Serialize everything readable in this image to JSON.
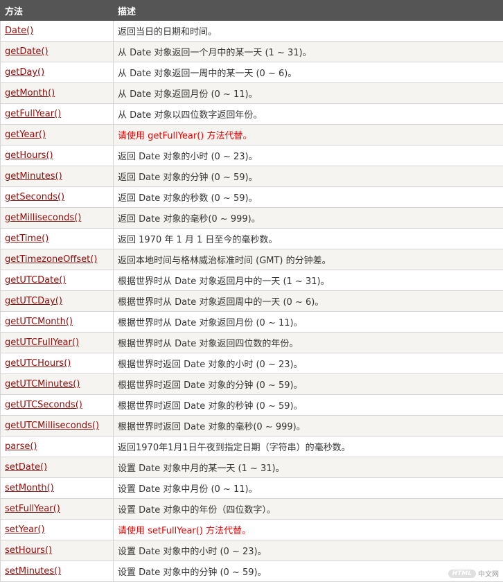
{
  "header": {
    "col_method": "方法",
    "col_desc": "描述"
  },
  "rows": [
    {
      "method": "Date()",
      "desc": "返回当日的日期和时间。",
      "warn": false
    },
    {
      "method": "getDate()",
      "desc": "从 Date 对象返回一个月中的某一天 (1 ~ 31)。",
      "warn": false
    },
    {
      "method": "getDay()",
      "desc": "从 Date 对象返回一周中的某一天 (0 ~ 6)。",
      "warn": false
    },
    {
      "method": "getMonth()",
      "desc": "从 Date 对象返回月份 (0 ~ 11)。",
      "warn": false
    },
    {
      "method": "getFullYear()",
      "desc": "从 Date 对象以四位数字返回年份。",
      "warn": false
    },
    {
      "method": "getYear()",
      "desc": "请使用 getFullYear() 方法代替。",
      "warn": true
    },
    {
      "method": "getHours()",
      "desc": "返回 Date 对象的小时 (0 ~ 23)。",
      "warn": false
    },
    {
      "method": "getMinutes()",
      "desc": "返回 Date 对象的分钟 (0 ~ 59)。",
      "warn": false
    },
    {
      "method": "getSeconds()",
      "desc": "返回 Date 对象的秒数 (0 ~ 59)。",
      "warn": false
    },
    {
      "method": "getMilliseconds()",
      "desc": "返回 Date 对象的毫秒(0 ~ 999)。",
      "warn": false
    },
    {
      "method": "getTime()",
      "desc": "返回 1970 年 1 月 1 日至今的毫秒数。",
      "warn": false
    },
    {
      "method": "getTimezoneOffset()",
      "desc": "返回本地时间与格林威治标准时间 (GMT) 的分钟差。",
      "warn": false
    },
    {
      "method": "getUTCDate()",
      "desc": "根据世界时从 Date 对象返回月中的一天 (1 ~ 31)。",
      "warn": false
    },
    {
      "method": "getUTCDay()",
      "desc": "根据世界时从 Date 对象返回周中的一天 (0 ~ 6)。",
      "warn": false
    },
    {
      "method": "getUTCMonth()",
      "desc": "根据世界时从 Date 对象返回月份 (0 ~ 11)。",
      "warn": false
    },
    {
      "method": "getUTCFullYear()",
      "desc": "根据世界时从 Date 对象返回四位数的年份。",
      "warn": false
    },
    {
      "method": "getUTCHours()",
      "desc": "根据世界时返回 Date 对象的小时 (0 ~ 23)。",
      "warn": false
    },
    {
      "method": "getUTCMinutes()",
      "desc": "根据世界时返回 Date 对象的分钟 (0 ~ 59)。",
      "warn": false
    },
    {
      "method": "getUTCSeconds()",
      "desc": "根据世界时返回 Date 对象的秒钟 (0 ~ 59)。",
      "warn": false
    },
    {
      "method": "getUTCMilliseconds()",
      "desc": "根据世界时返回 Date 对象的毫秒(0 ~ 999)。",
      "warn": false
    },
    {
      "method": "parse()",
      "desc": "返回1970年1月1日午夜到指定日期（字符串）的毫秒数。",
      "warn": false
    },
    {
      "method": "setDate()",
      "desc": "设置 Date 对象中月的某一天 (1 ~ 31)。",
      "warn": false
    },
    {
      "method": "setMonth()",
      "desc": "设置 Date 对象中月份 (0 ~ 11)。",
      "warn": false
    },
    {
      "method": "setFullYear()",
      "desc": "设置 Date 对象中的年份（四位数字）。",
      "warn": false
    },
    {
      "method": "setYear()",
      "desc": "请使用 setFullYear() 方法代替。",
      "warn": true
    },
    {
      "method": "setHours()",
      "desc": "设置 Date 对象中的小时 (0 ~ 23)。",
      "warn": false
    },
    {
      "method": "setMinutes()",
      "desc": "设置 Date 对象中的分钟 (0 ~ 59)。",
      "warn": false
    }
  ],
  "watermark": {
    "logo": "HTML",
    "text": "中文网"
  },
  "colors": {
    "header_bg": "#555555",
    "link": "#900b09",
    "warn": "#e80000",
    "row_alt": "#f6f4f0"
  }
}
